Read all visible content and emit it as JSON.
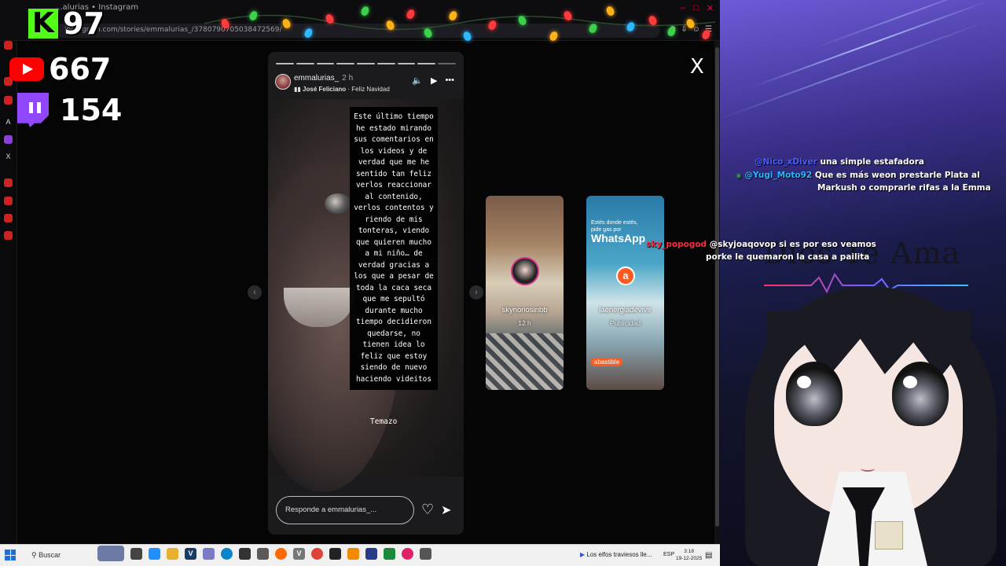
{
  "browser": {
    "tab_label": "...alurias • Instagram",
    "url": "instagram.com/stories/emmalurias_/3780790705038472569/",
    "sidebar_marks": [
      "A",
      "X"
    ]
  },
  "overlay": {
    "kick_label": "K",
    "kick_count": "97",
    "youtube_count": "667",
    "twitch_count": "154"
  },
  "story": {
    "close_label": "X",
    "username": "emmalurias_",
    "time": "2 h",
    "song_artist": "José Feliciano",
    "song_title": " · Feliz Navidad",
    "caption": "Este último tiempo\nhe estado mirando\nsus comentarios en\nlos videos y de\nverdad que me he\nsentido tan feliz\nverlos reaccionar\nal contenido,\nverlos contentos y\nriendo de mis\ntonteras, viendo\nque quieren mucho\na mi niño… de\nverdad gracias a\nlos que a pesar de\ntoda la caca seca\nque me sepultó\ndurante mucho\ntiempo decidieron\nquedarse, no\ntienen idea lo\nfeliz que estoy\nsiendo de nuevo\nhaciendo videitos",
    "sticker_text": "Temazo",
    "reply_placeholder": "Responde a emmalurias_...",
    "progress_segments": 9,
    "current_segment": 9
  },
  "cards": [
    {
      "name": "skynoriosinbb",
      "sub": "12 h"
    },
    {
      "name": "laenergiadevivir",
      "sub": "Publicidad",
      "ad_line1": "Estés donde estés,",
      "ad_line2": "pide gas por",
      "ad_brand": "WhatsApp",
      "ad_logo": "abastible"
    }
  ],
  "chat": [
    {
      "user": "@Nico_xDiver",
      "message": "una simple estafadora",
      "user_color": "#4a5cff"
    },
    {
      "user": "@Yugi_Moto92",
      "message": "Que es más weon prestarle Plata al",
      "message2": "Markush o comprarle rifas a la Emma",
      "user_color": "#29b6ff"
    },
    {
      "user": "sky_popogod",
      "message": "@skyjoaqovop si es por eso veamos",
      "message2": "porke le quemaron la casa a pailita",
      "user_color": "#ff2a3d"
    }
  ],
  "stream_bg_text": "Dios Te Ama",
  "taskbar": {
    "search_label": "Buscar",
    "media_label": "Los elfos traviesos lle...",
    "lang": "ESP",
    "time": "3:18",
    "date": "19-12-2025"
  },
  "colors": {
    "kick": "#53fc18",
    "youtube": "#ff0000",
    "twitch": "#9146ff",
    "story_bg": "#1b1b1d"
  }
}
